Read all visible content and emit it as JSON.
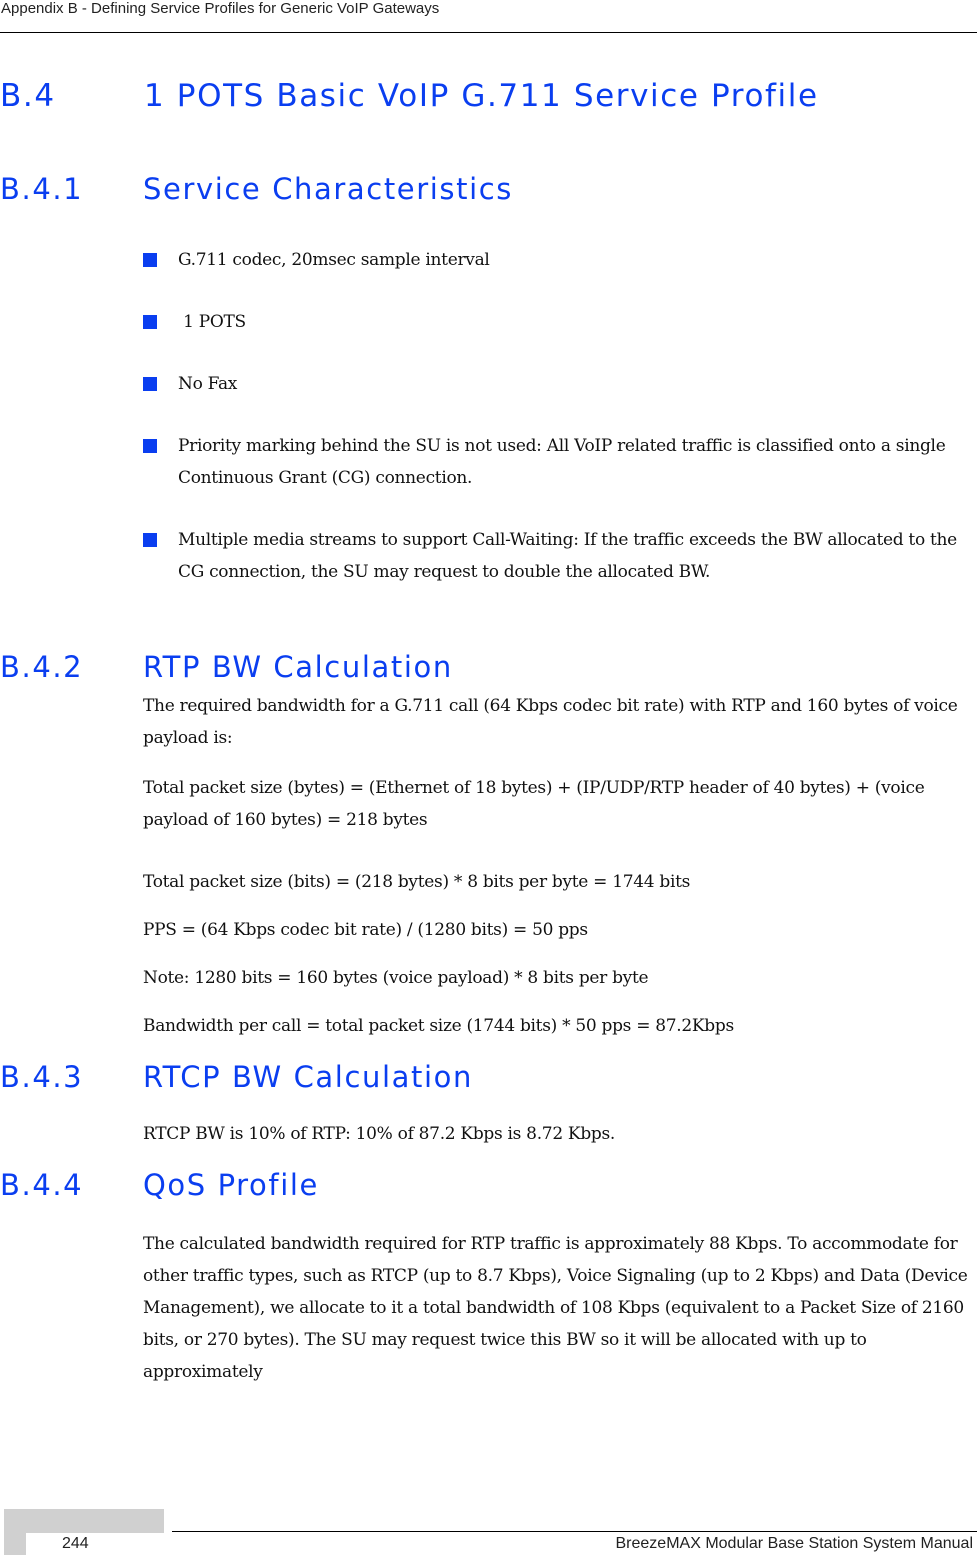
{
  "header": {
    "running_title": "Appendix B - Defining Service Profiles for Generic VoIP Gateways"
  },
  "section": {
    "number": "B.4",
    "title": "1 POTS Basic VoIP G.711 Service Profile"
  },
  "subsections": [
    {
      "number": "B.4.1",
      "title": "Service Characteristics",
      "bullets": [
        "G.711 codec, 20msec sample interval",
        " 1 POTS",
        "No Fax",
        "Priority marking behind the SU is not used: All VoIP related traffic is classified onto a single Continuous Grant (CG) connection.",
        "Multiple media streams to support Call-Waiting: If the traffic exceeds the BW allocated to the CG connection, the SU may request to double the allocated BW."
      ]
    },
    {
      "number": "B.4.2",
      "title": "RTP BW Calculation",
      "paragraphs": [
        "The required bandwidth for a G.711 call (64 Kbps codec bit rate) with RTP and 160 bytes of voice payload is:",
        "Total packet size (bytes) = (Ethernet of 18 bytes) + (IP/UDP/RTP header of 40 bytes) + (voice payload of 160 bytes) = 218 bytes",
        "Total packet size (bits) = (218 bytes) * 8 bits per byte = 1744 bits",
        "PPS = (64 Kbps codec bit rate) / (1280 bits) = 50 pps",
        "Note: 1280 bits = 160 bytes (voice payload) * 8 bits per byte",
        "Bandwidth per call = total packet size (1744 bits) * 50 pps = 87.2Kbps"
      ]
    },
    {
      "number": "B.4.3",
      "title": "RTCP BW Calculation",
      "paragraphs": [
        "RTCP BW is 10% of RTP: 10% of 87.2 Kbps is 8.72 Kbps."
      ]
    },
    {
      "number": "B.4.4",
      "title": "QoS Profile",
      "paragraphs": [
        "The calculated bandwidth required for RTP traffic is approximately 88 Kbps. To accommodate for other traffic types, such as RTCP (up to 8.7 Kbps), Voice Signaling (up to 2 Kbps) and Data (Device Management), we allocate to it a total bandwidth of 108 Kbps (equivalent to a Packet Size of 2160 bits, or 270 bytes). The SU may request twice this BW so it will be allocated with up to approximately"
      ]
    }
  ],
  "footer": {
    "page_number": "244",
    "manual_title": "BreezeMAX Modular Base Station System Manual"
  },
  "colors": {
    "heading_blue": "#0a3ef0",
    "bullet_blue": "#0a3ef0"
  }
}
